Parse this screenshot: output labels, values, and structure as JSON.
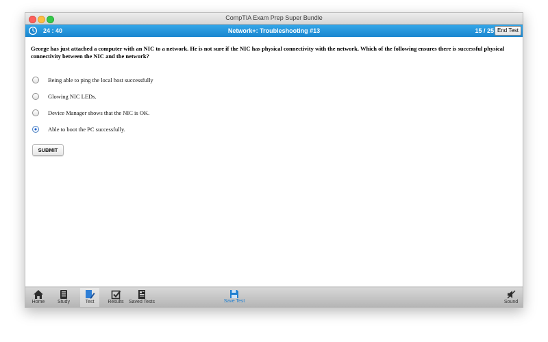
{
  "window": {
    "title": "CompTIA Exam Prep Super Bundle"
  },
  "header": {
    "timer": "24 : 40",
    "question_title": "Network+: Troubleshooting #13",
    "counter": "15 / 25",
    "end_test_label": "End Test"
  },
  "question": {
    "text": "George has just attached a computer with an NIC to a network. He is not sure if the NIC has physical connectivity with the network. Which of the following ensures there is successful physical connectivity between the NIC and the network?",
    "options": [
      {
        "label": "Being able to ping the local host successfully",
        "selected": false
      },
      {
        "label": "Glowing NIC LEDs.",
        "selected": false
      },
      {
        "label": "Device Manager shows that the NIC is OK.",
        "selected": false
      },
      {
        "label": "Able to boot the PC successfully.",
        "selected": true
      }
    ],
    "submit_label": "SUBMIT"
  },
  "toolbar": {
    "home": "Home",
    "study": "Study",
    "test": "Test",
    "results": "Results",
    "saved_tests": "Saved Tests",
    "save_test": "Save Test",
    "sound": "Sound"
  },
  "colors": {
    "header_blue": "#1a86cf",
    "accent": "#1f7fd0"
  }
}
